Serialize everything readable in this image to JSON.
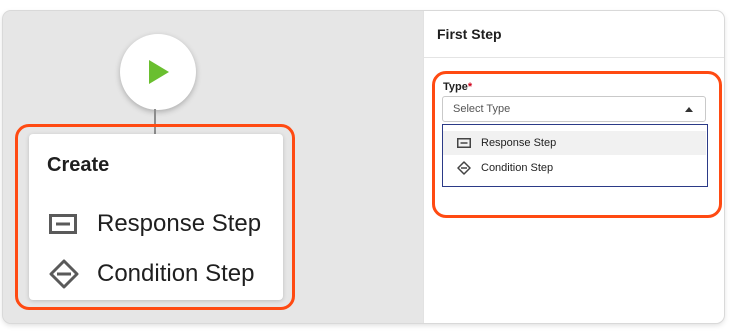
{
  "canvas": {
    "start_node": {
      "icon": "play-icon",
      "color": "#6abf2f"
    },
    "create_menu": {
      "title": "Create",
      "options": [
        {
          "label": "Response Step",
          "icon": "response-step-icon"
        },
        {
          "label": "Condition Step",
          "icon": "condition-step-icon"
        }
      ]
    }
  },
  "panel": {
    "title": "First Step",
    "type_field": {
      "label": "Type",
      "required_marker": "*",
      "placeholder": "Select Type",
      "options": [
        {
          "label": "Response Step",
          "icon": "response-step-icon"
        },
        {
          "label": "Condition Step",
          "icon": "condition-step-icon"
        }
      ]
    }
  },
  "colors": {
    "highlight": "#ff4a12",
    "accent": "#2b3a87",
    "play": "#6abf2f",
    "required": "#d0021b"
  }
}
